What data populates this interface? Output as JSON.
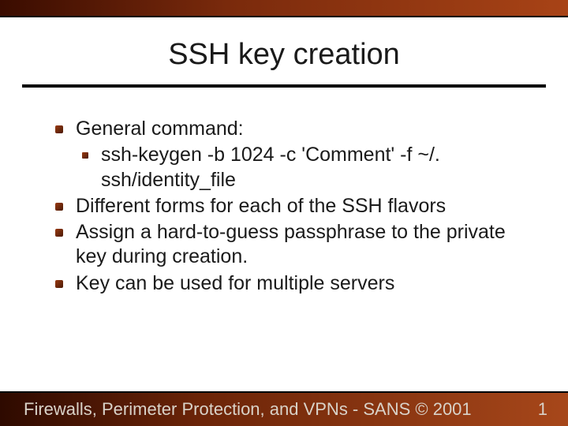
{
  "title": "SSH key creation",
  "bullets": {
    "b0": "General command:",
    "b0_sub": "ssh-keygen -b 1024 -c 'Comment' -f ~/. ssh/identity_file",
    "b1": "Different forms for each of the SSH flavors",
    "b2": "Assign a hard-to-guess passphrase to the private key during creation.",
    "b3": "Key can be used for multiple servers"
  },
  "footer": {
    "text": "Firewalls, Perimeter Protection, and VPNs - SANS © 2001",
    "page": "1"
  }
}
